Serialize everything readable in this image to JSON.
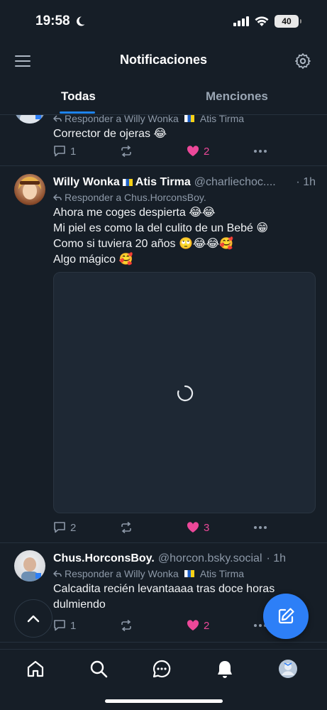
{
  "status": {
    "time": "19:58",
    "battery": "40"
  },
  "header": {
    "title": "Notificaciones"
  },
  "tabs": [
    {
      "label": "Todas"
    },
    {
      "label": "Menciones"
    }
  ],
  "posts": [
    {
      "reply_to": "Responder a Willy Wonka",
      "reply_to_suffix": "Atis Tirma",
      "text": "Corrector de ojeras 😂",
      "replies": "1",
      "likes": "2"
    },
    {
      "author": "Willy Wonka",
      "author_suffix": "Atis Tirma",
      "handle": "@charliechoc....",
      "time": "· 1h",
      "reply_to": "Responder a Chus.HorconsBoy.",
      "lines": [
        "Ahora me coges despierta 😂😂",
        "Mi piel es como la del culito de un Bebé 😁",
        "Como si tuviera 20 años 🙄😂😂🥰",
        "Algo mágico 🥰"
      ],
      "replies": "2",
      "likes": "3"
    },
    {
      "author": "Chus.HorconsBoy.",
      "handle": "@horcon.bsky.social",
      "time": "· 1h",
      "reply_to": "Responder a Willy Wonka",
      "reply_to_suffix": "Atis Tirma",
      "lines": [
        "Calcadita recién levantaaaa tras doce horas",
        "dulmiendo"
      ],
      "replies": "1",
      "likes": "2"
    }
  ],
  "icons": {
    "menu": "menu-icon",
    "settings": "gear-icon",
    "reply": "reply-icon",
    "repost": "repost-icon",
    "like": "heart-icon",
    "more": "more-icon",
    "compose": "compose-icon",
    "scroll_top": "chevron-up-icon",
    "home": "home-icon",
    "search": "search-icon",
    "chat": "chat-icon",
    "notifications": "bell-icon"
  },
  "colors": {
    "background": "#161e27",
    "accent": "#1d84f0",
    "like": "#ec4899",
    "compose": "#2d7ff7"
  }
}
